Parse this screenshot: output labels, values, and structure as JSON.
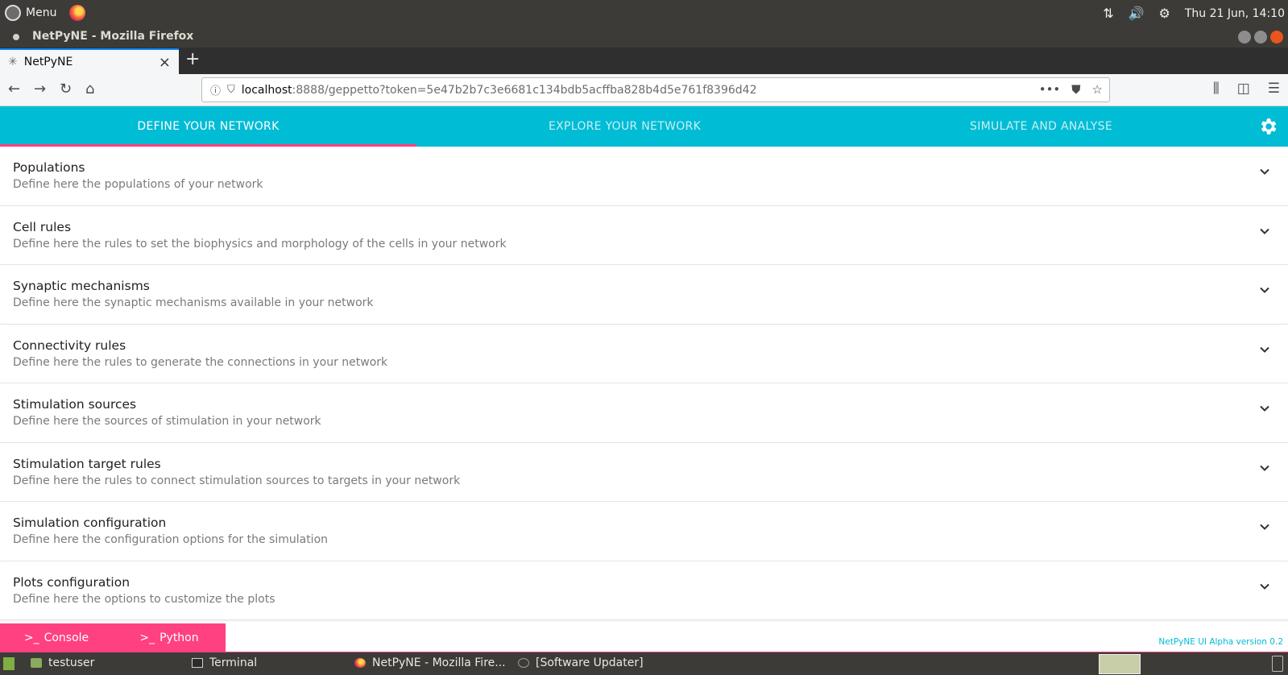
{
  "system_panel": {
    "menu_label": "Menu",
    "datetime": "Thu 21 Jun, 14:10"
  },
  "window": {
    "title": "NetPyNE - Mozilla Firefox"
  },
  "browser": {
    "tab_title": "NetPyNE",
    "url_host": "localhost",
    "url_rest": ":8888/geppetto?token=5e47b2b7c3e6681c134bdb5acffba828b4d5e761f8396d42"
  },
  "app": {
    "tabs": [
      {
        "label": "DEFINE YOUR NETWORK"
      },
      {
        "label": "EXPLORE YOUR NETWORK"
      },
      {
        "label": "SIMULATE AND ANALYSE"
      }
    ],
    "panels": [
      {
        "title": "Populations",
        "subtitle": "Define here the populations of your network"
      },
      {
        "title": "Cell rules",
        "subtitle": "Define here the rules to set the biophysics and morphology of the cells in your network"
      },
      {
        "title": "Synaptic mechanisms",
        "subtitle": "Define here the synaptic mechanisms available in your network"
      },
      {
        "title": "Connectivity rules",
        "subtitle": "Define here the rules to generate the connections in your network"
      },
      {
        "title": "Stimulation sources",
        "subtitle": "Define here the sources of stimulation in your network"
      },
      {
        "title": "Stimulation target rules",
        "subtitle": "Define here the rules to connect stimulation sources to targets in your network"
      },
      {
        "title": "Simulation configuration",
        "subtitle": "Define here the configuration options for the simulation"
      },
      {
        "title": "Plots configuration",
        "subtitle": "Define here the options to customize the plots"
      }
    ],
    "console_label": "Console",
    "python_label": "Python",
    "version": "NetPyNE UI Alpha version 0.2",
    "accent_color": "#00bcd4",
    "highlight_color": "#ff4081"
  },
  "taskbar": {
    "items": [
      {
        "label": "testuser",
        "icon": "folder-icon"
      },
      {
        "label": "Terminal",
        "icon": "terminal-icon"
      },
      {
        "label": "NetPyNE - Mozilla Fire...",
        "icon": "firefox-icon"
      },
      {
        "label": "[Software Updater]",
        "icon": "updater-icon"
      }
    ]
  }
}
